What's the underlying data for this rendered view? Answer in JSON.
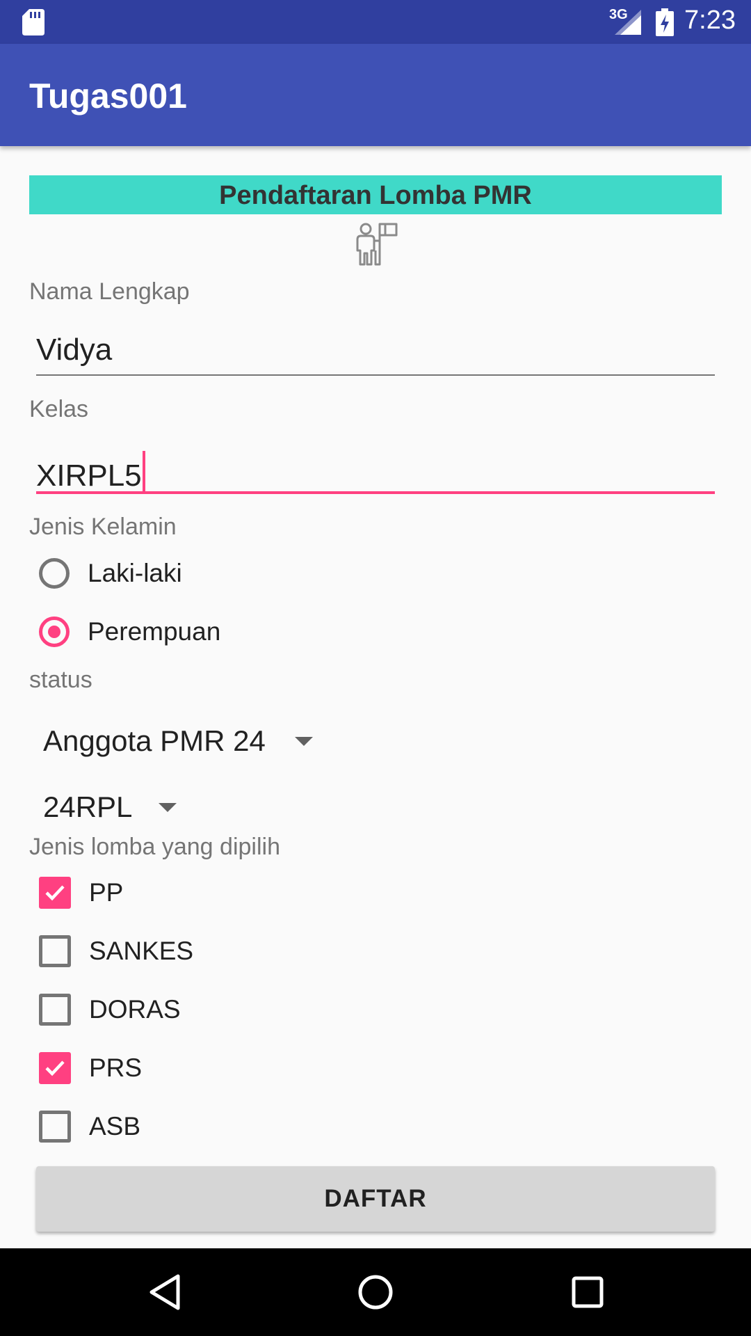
{
  "status_bar": {
    "network": "3G",
    "time": "7:23"
  },
  "app_bar": {
    "title": "Tugas001"
  },
  "form": {
    "banner": "Pendaftaran Lomba PMR",
    "banner_icon": "person-with-flag-icon",
    "name_label": "Nama Lengkap",
    "name_value": "Vidya",
    "class_label": "Kelas",
    "class_value": "XIRPL5",
    "gender_label": "Jenis Kelamin",
    "gender_options": [
      {
        "label": "Laki-laki",
        "selected": false
      },
      {
        "label": "Perempuan",
        "selected": true
      }
    ],
    "status_label": "status",
    "status_spinner": "Anggota PMR 24",
    "group_spinner": "24RPL",
    "lomba_label": "Jenis lomba yang dipilih",
    "lomba_options": [
      {
        "label": "PP",
        "checked": true
      },
      {
        "label": "SANKES",
        "checked": false
      },
      {
        "label": "DORAS",
        "checked": false
      },
      {
        "label": "PRS",
        "checked": true
      },
      {
        "label": "ASB",
        "checked": false
      }
    ],
    "submit_label": "DAFTAR"
  },
  "colors": {
    "status_bar": "#303f9f",
    "app_bar": "#3f51b5",
    "accent": "#ff4081",
    "banner": "#40d9c8"
  }
}
